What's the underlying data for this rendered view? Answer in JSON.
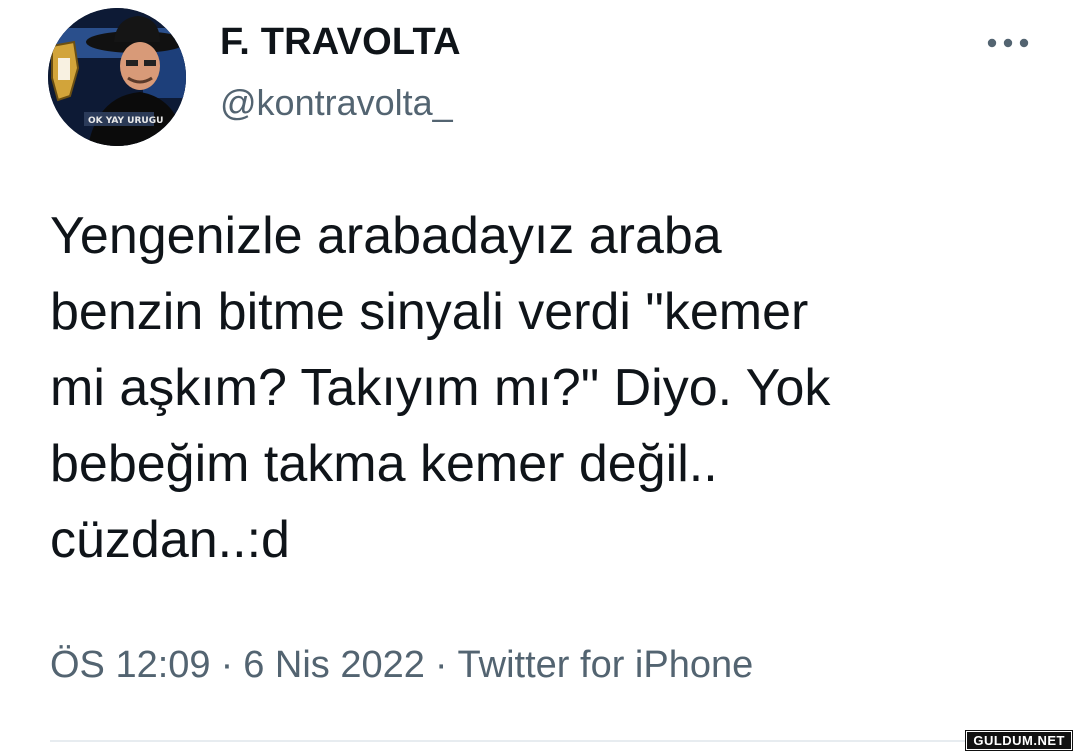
{
  "tweet": {
    "author": {
      "display_name": "F. TRAVOLTA",
      "handle": "@kontravolta_",
      "avatar_icon": "profile-avatar-icon"
    },
    "more_icon": "more-options-icon",
    "text": "Yengenizle arabadayız araba\nbenzin bitme sinyali verdi \"kemer\nmi aşkım? Takıyım mı?\" Diyo. Yok\nbebeğim takma kemer değil..\ncüzdan..:d",
    "time": "ÖS 12:09",
    "date": "6 Nis 2022",
    "source": "Twitter for iPhone",
    "separator": "·"
  },
  "watermark": "GULDUM.NET",
  "colors": {
    "text_primary": "#0f1419",
    "text_secondary": "#536471",
    "divider": "#e7ecf0"
  }
}
